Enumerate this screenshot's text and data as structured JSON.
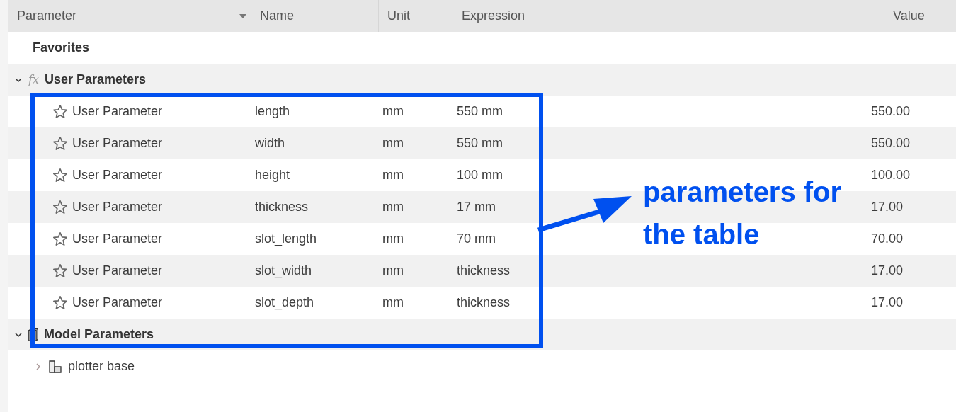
{
  "columns": [
    {
      "label": "Parameter",
      "sortable": true
    },
    {
      "label": "Name",
      "sortable": false
    },
    {
      "label": "Unit",
      "sortable": false
    },
    {
      "label": "Expression",
      "sortable": false
    },
    {
      "label": "Value",
      "sortable": false
    }
  ],
  "groups": [
    {
      "kind": "favorites",
      "label": "Favorites"
    },
    {
      "kind": "user",
      "label": "User Parameters",
      "icon_text": "fx",
      "expanded": true,
      "children": [
        {
          "kind": "param",
          "parameter": "User Parameter",
          "name": "length",
          "unit": "mm",
          "expression": "550 mm",
          "value": "550.00",
          "favorite": false
        },
        {
          "kind": "param",
          "parameter": "User Parameter",
          "name": "width",
          "unit": "mm",
          "expression": "550 mm",
          "value": "550.00",
          "favorite": false
        },
        {
          "kind": "param",
          "parameter": "User Parameter",
          "name": "height",
          "unit": "mm",
          "expression": "100 mm",
          "value": "100.00",
          "favorite": false
        },
        {
          "kind": "param",
          "parameter": "User Parameter",
          "name": "thickness",
          "unit": "mm",
          "expression": "17 mm",
          "value": "17.00",
          "favorite": false
        },
        {
          "kind": "param",
          "parameter": "User Parameter",
          "name": "slot_length",
          "unit": "mm",
          "expression": "70 mm",
          "value": "70.00",
          "favorite": false
        },
        {
          "kind": "param",
          "parameter": "User Parameter",
          "name": "slot_width",
          "unit": "mm",
          "expression": "thickness",
          "value": "17.00",
          "favorite": false
        },
        {
          "kind": "param",
          "parameter": "User Parameter",
          "name": "slot_depth",
          "unit": "mm",
          "expression": "thickness",
          "value": "17.00",
          "favorite": false
        }
      ]
    },
    {
      "kind": "model",
      "label": "Model Parameters",
      "expanded": true,
      "children": [
        {
          "kind": "component",
          "label": "plotter base",
          "expanded": false
        }
      ]
    }
  ],
  "annotation": {
    "lines": [
      "parameters for",
      "the table"
    ]
  }
}
